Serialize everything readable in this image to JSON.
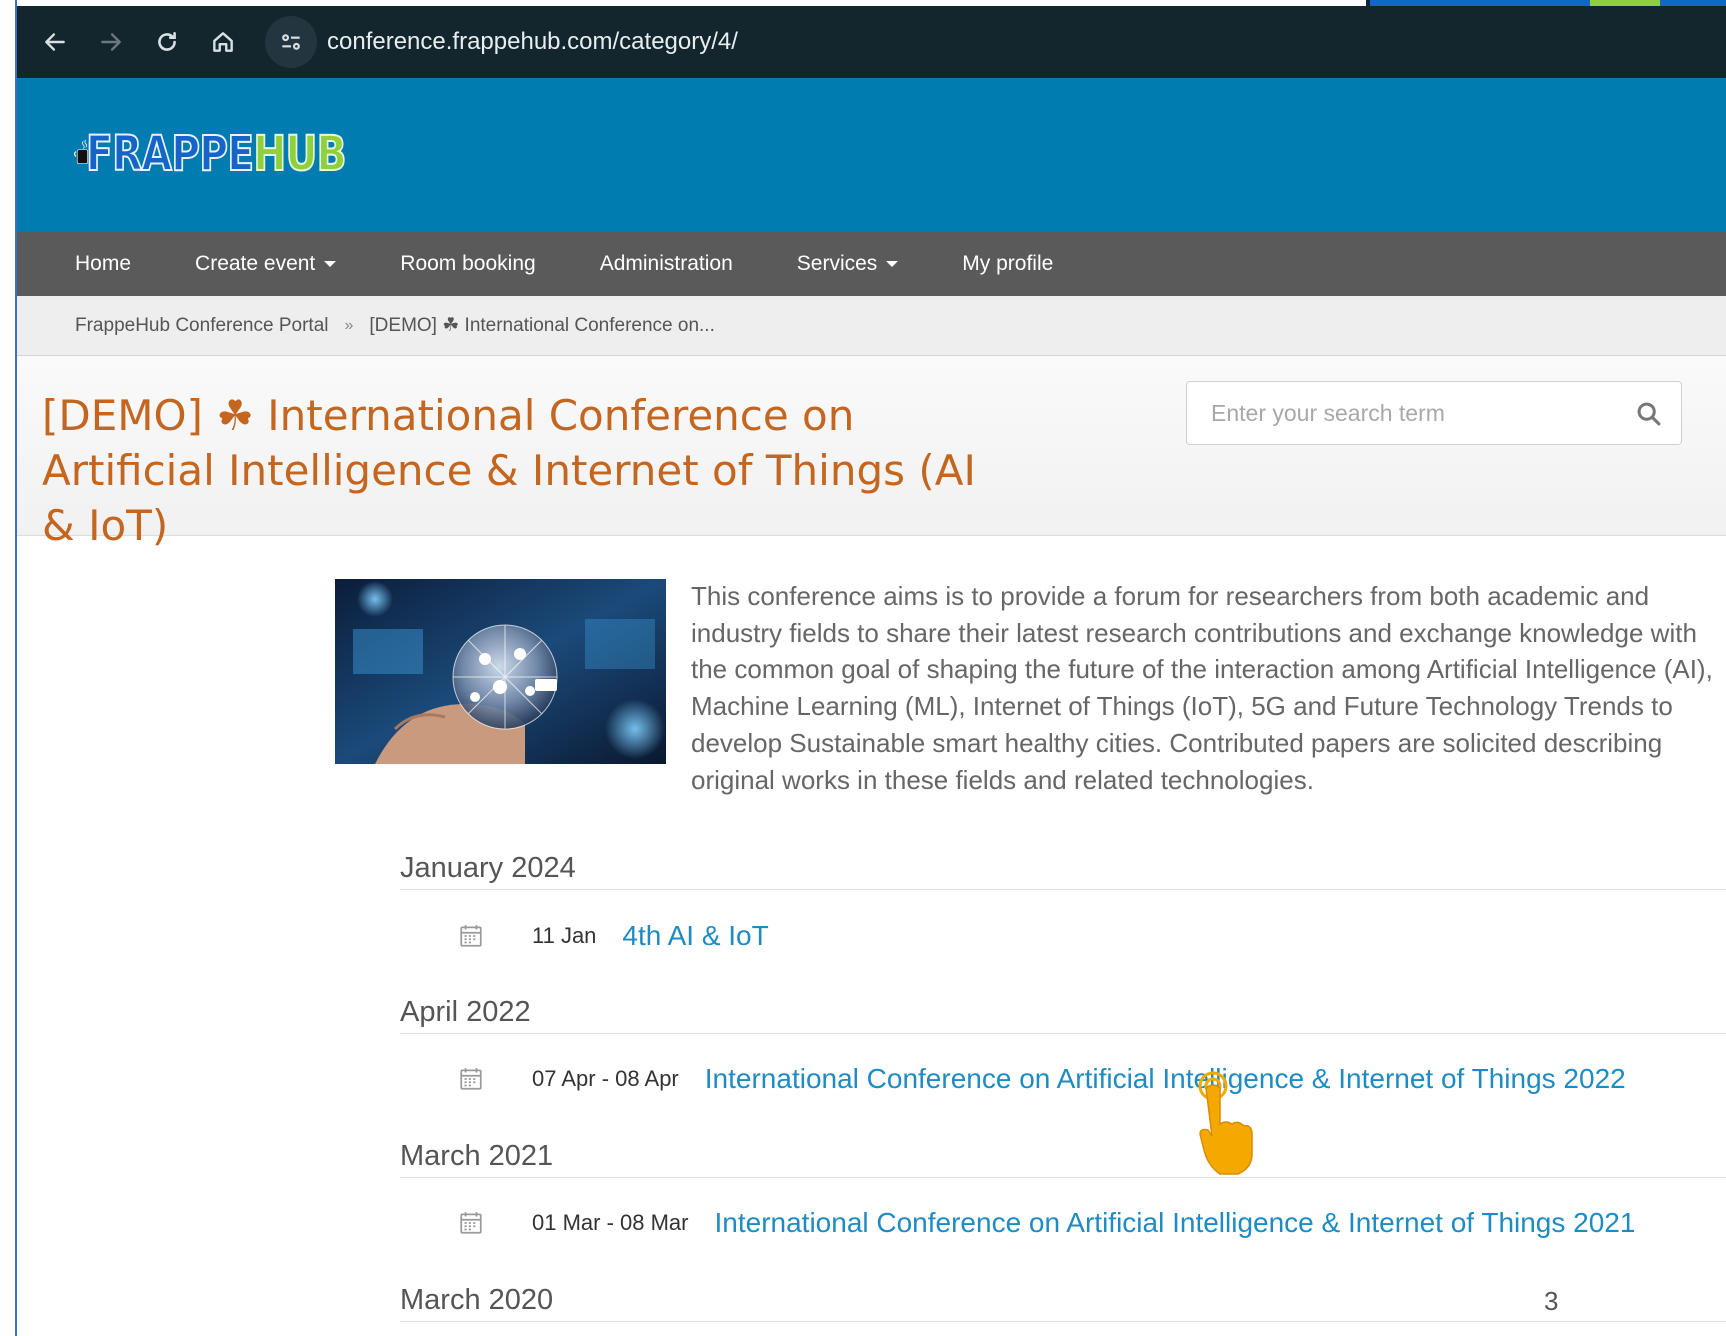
{
  "browser": {
    "url": "conference.frappehub.com/category/4/",
    "icons": [
      "back-arrow-icon",
      "forward-arrow-icon",
      "reload-icon",
      "home-icon",
      "site-settings-icon"
    ]
  },
  "site": {
    "logo_text_1": "FRAPPE",
    "logo_text_2": "HUB",
    "colors": {
      "header_bg": "#017cb0",
      "nav_bg": "#5a5a5a",
      "title": "#c4661f",
      "link": "#1e8bc3"
    }
  },
  "nav": {
    "items": [
      {
        "label": "Home",
        "dropdown": false
      },
      {
        "label": "Create event",
        "dropdown": true
      },
      {
        "label": "Room booking",
        "dropdown": false
      },
      {
        "label": "Administration",
        "dropdown": false
      },
      {
        "label": "Services",
        "dropdown": true
      },
      {
        "label": "My profile",
        "dropdown": false
      }
    ]
  },
  "breadcrumb": {
    "root": "FrappeHub Conference Portal",
    "separator": "»",
    "current": "[DEMO] ☘ International Conference on..."
  },
  "page": {
    "title": "[DEMO] ☘ International Conference on Artificial Intelligence & Internet of Things (AI & IoT)",
    "description": "This conference aims is to provide a forum for researchers from both academic and industry fields to share their latest research contributions and exchange knowledge with the common goal of shaping the future of the interaction among Artificial Intelligence (AI), Machine Learning (ML), Internet of Things (IoT), 5G and Future Technology Trends to develop Sustainable smart healthy cities. Contributed papers are solicited describing original works in these fields and related technologies."
  },
  "search": {
    "placeholder": "Enter your search term"
  },
  "events": {
    "groups": [
      {
        "month": "January 2024",
        "date": "11 Jan",
        "title": "4th AI & IoT"
      },
      {
        "month": "April 2022",
        "date": "07 Apr - 08 Apr",
        "title": "International Conference on Artificial Intelligence & Internet of Things 2022"
      },
      {
        "month": "March 2021",
        "date": "01 Mar - 08 Mar",
        "title": "International Conference on Artificial Intelligence & Internet of Things 2021"
      },
      {
        "month": "March 2020"
      }
    ]
  },
  "overlay": {
    "page_number": "3"
  }
}
